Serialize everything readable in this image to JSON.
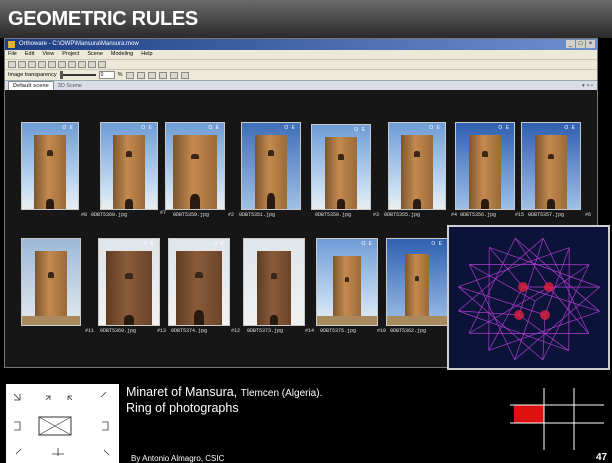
{
  "slide": {
    "title": "GEOMETRIC RULES",
    "caption_line1": "Minaret of Mansura,",
    "caption_location": "Tlemcen (Algeria).",
    "caption_line2": "Ring of photographs",
    "author": "By Antonio Almagro, CSIC",
    "page_number": "47"
  },
  "app": {
    "window_title": "Orthoware - C:\\OWP\\Mansura\\Mansura.mow",
    "window_controls": [
      "_",
      "□",
      "×"
    ],
    "menu": [
      "File",
      "Edit",
      "View",
      "Project",
      "Scene",
      "Modeling",
      "Help"
    ],
    "transparency_label": "Image transparency",
    "transparency_value": "0",
    "transparency_unit": "%",
    "tabs": {
      "active": "Default scene",
      "other": "3D Scene"
    },
    "tab_right": "▾ × •"
  },
  "photos": {
    "row1": [
      {
        "label": "#8",
        "file": ""
      },
      {
        "label": "",
        "file": "0DBT5360.jpg"
      },
      {
        "label": "#7",
        "file": "0DBT5359.jpg"
      },
      {
        "label": "#2",
        "file": "0DBT5351.jpg"
      },
      {
        "label": "",
        "file": "0DBT5350.jpg"
      },
      {
        "label": "#3",
        "file": "0DBT5355.jpg"
      },
      {
        "label": "#4",
        "file": "0DBT5356.jpg"
      },
      {
        "label": "#15",
        "file": "0DBT5357.jpg"
      },
      {
        "label": "#6",
        "file": ""
      }
    ],
    "row2": [
      {
        "label": "#11",
        "file": "0DBT5369.jpg"
      },
      {
        "label": "#13",
        "file": "0DBT5374.jpg"
      },
      {
        "label": "#12",
        "file": "0DBT5373.jpg"
      },
      {
        "label": "#14",
        "file": "0DBT5375.jpg"
      },
      {
        "label": "#10",
        "file": "0DBT5362.jpg"
      }
    ],
    "orientation_mark": "O E"
  },
  "colors": {
    "camera_lines": "#c040e0",
    "inset_background": "#0c1338",
    "highlight_red": "#e01010"
  }
}
